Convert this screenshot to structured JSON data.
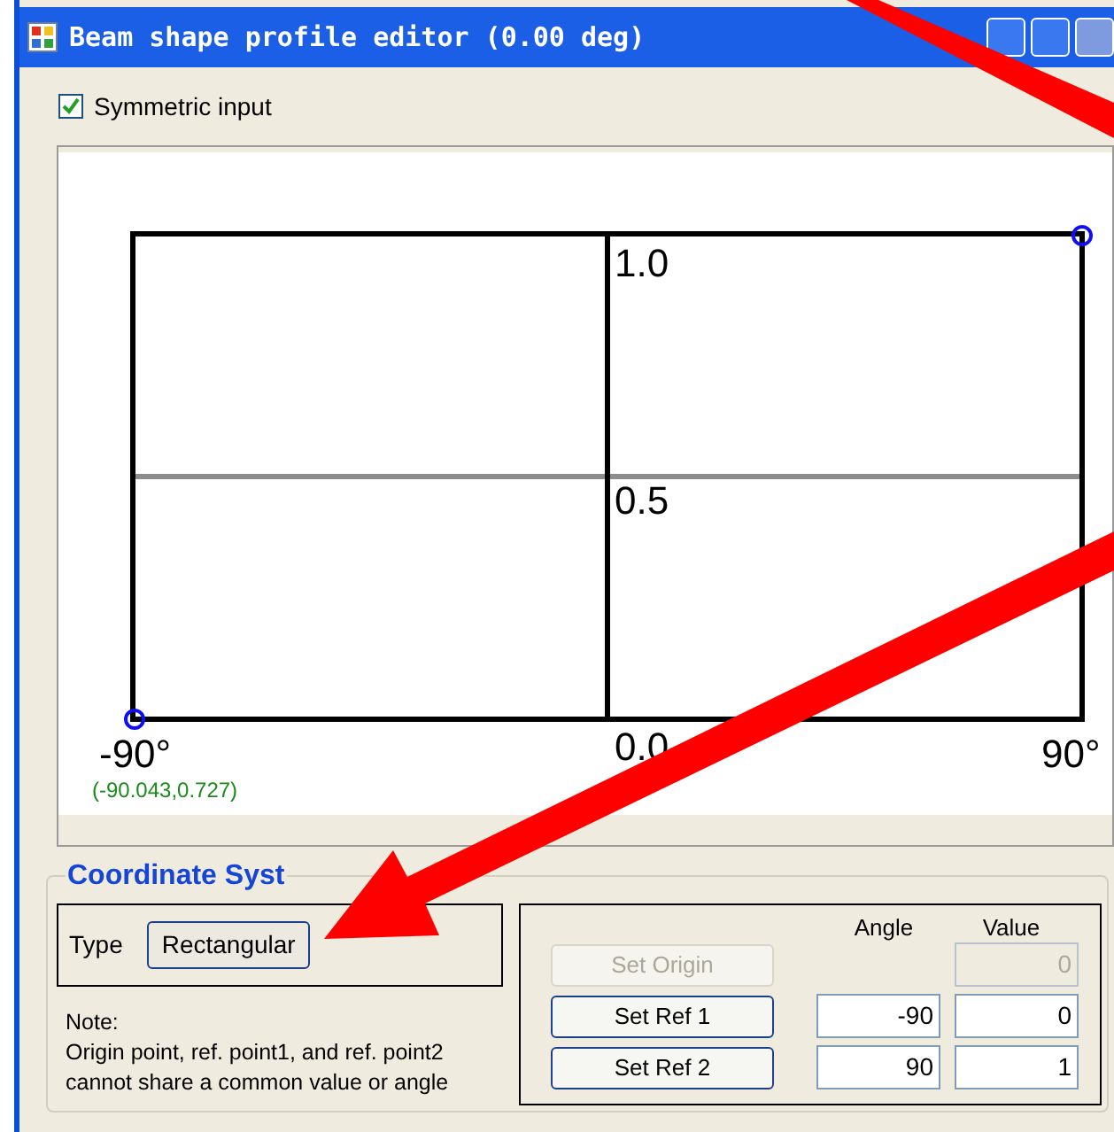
{
  "window": {
    "title": "Beam shape profile editor (0.00 deg)"
  },
  "symmetric_input": {
    "label": "Symmetric input",
    "checked": true
  },
  "plot": {
    "y_labels": [
      "1.0",
      "0.5",
      "0.0"
    ],
    "x_labels": [
      "-90°",
      "90°"
    ],
    "cursor_readout": "(-90.043,0.727)"
  },
  "coordinate_system": {
    "title": "Coordinate Syst",
    "type_label": "Type",
    "type_value": "Rectangular",
    "note": [
      "Note:",
      "Origin point, ref. point1, and ref. point2",
      "cannot share a common value or angle"
    ],
    "columns": [
      "Angle",
      "Value"
    ],
    "rows": [
      {
        "button": "Set Origin",
        "disabled": true,
        "angle": "",
        "value": "0"
      },
      {
        "button": "Set Ref 1",
        "disabled": false,
        "angle": "-90",
        "value": "0"
      },
      {
        "button": "Set Ref 2",
        "disabled": false,
        "angle": "90",
        "value": "1"
      }
    ]
  }
}
